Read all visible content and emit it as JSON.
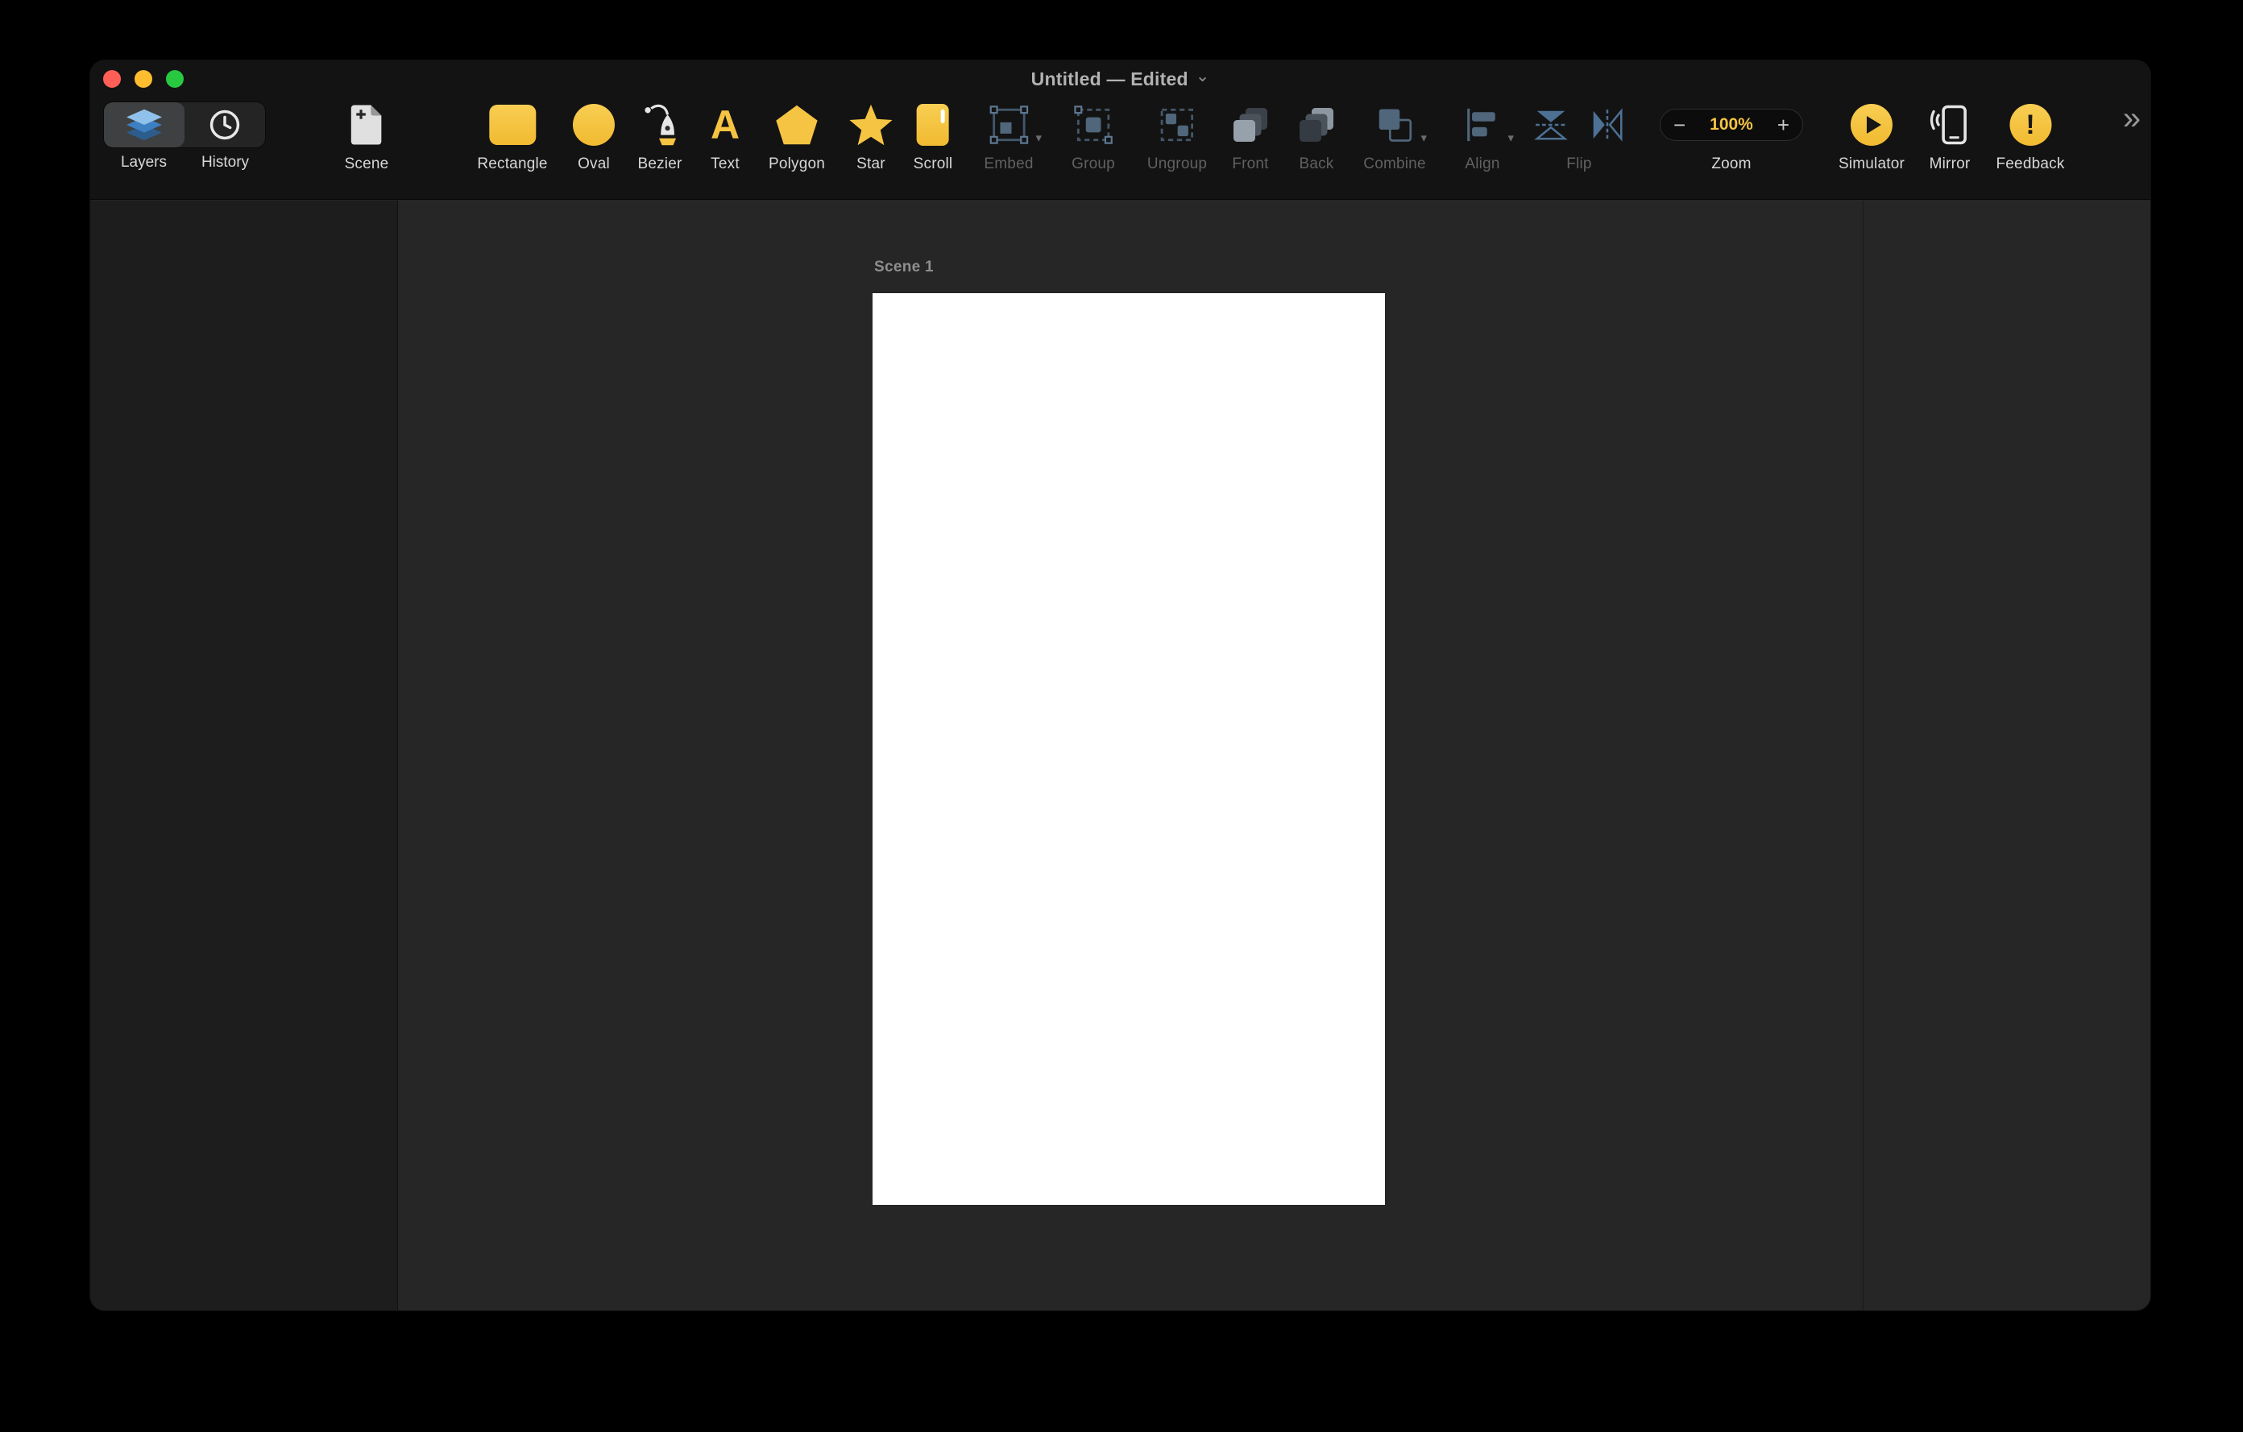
{
  "window": {
    "title": "Untitled — Edited",
    "title_chevron": "⌄",
    "overflow_chevron": "»"
  },
  "panel_switcher": {
    "layers": "Layers",
    "history": "History"
  },
  "toolbar": {
    "scene": "Scene",
    "rectangle": "Rectangle",
    "oval": "Oval",
    "bezier": "Bezier",
    "text": "Text",
    "text_glyph": "A",
    "polygon": "Polygon",
    "star": "Star",
    "scroll": "Scroll",
    "embed": "Embed",
    "group": "Group",
    "ungroup": "Ungroup",
    "front": "Front",
    "back": "Back",
    "combine": "Combine",
    "align": "Align",
    "flip": "Flip",
    "zoom": "Zoom",
    "zoom_value": "100%",
    "zoom_out": "−",
    "zoom_in": "+",
    "simulator": "Simulator",
    "mirror": "Mirror",
    "feedback": "Feedback",
    "feedback_glyph": "!",
    "dropdown_glyph": "▾"
  },
  "canvas": {
    "scene_label": "Scene 1"
  },
  "colors": {
    "accent": "#F5C443",
    "traffic_red": "#FF5F57",
    "traffic_yellow": "#FEBC2E",
    "traffic_green": "#28C840",
    "toolbar_bg": "#131313",
    "sidebar_bg": "#1D1D1D",
    "canvas_bg": "#262626",
    "artboard_bg": "#FFFFFF"
  }
}
